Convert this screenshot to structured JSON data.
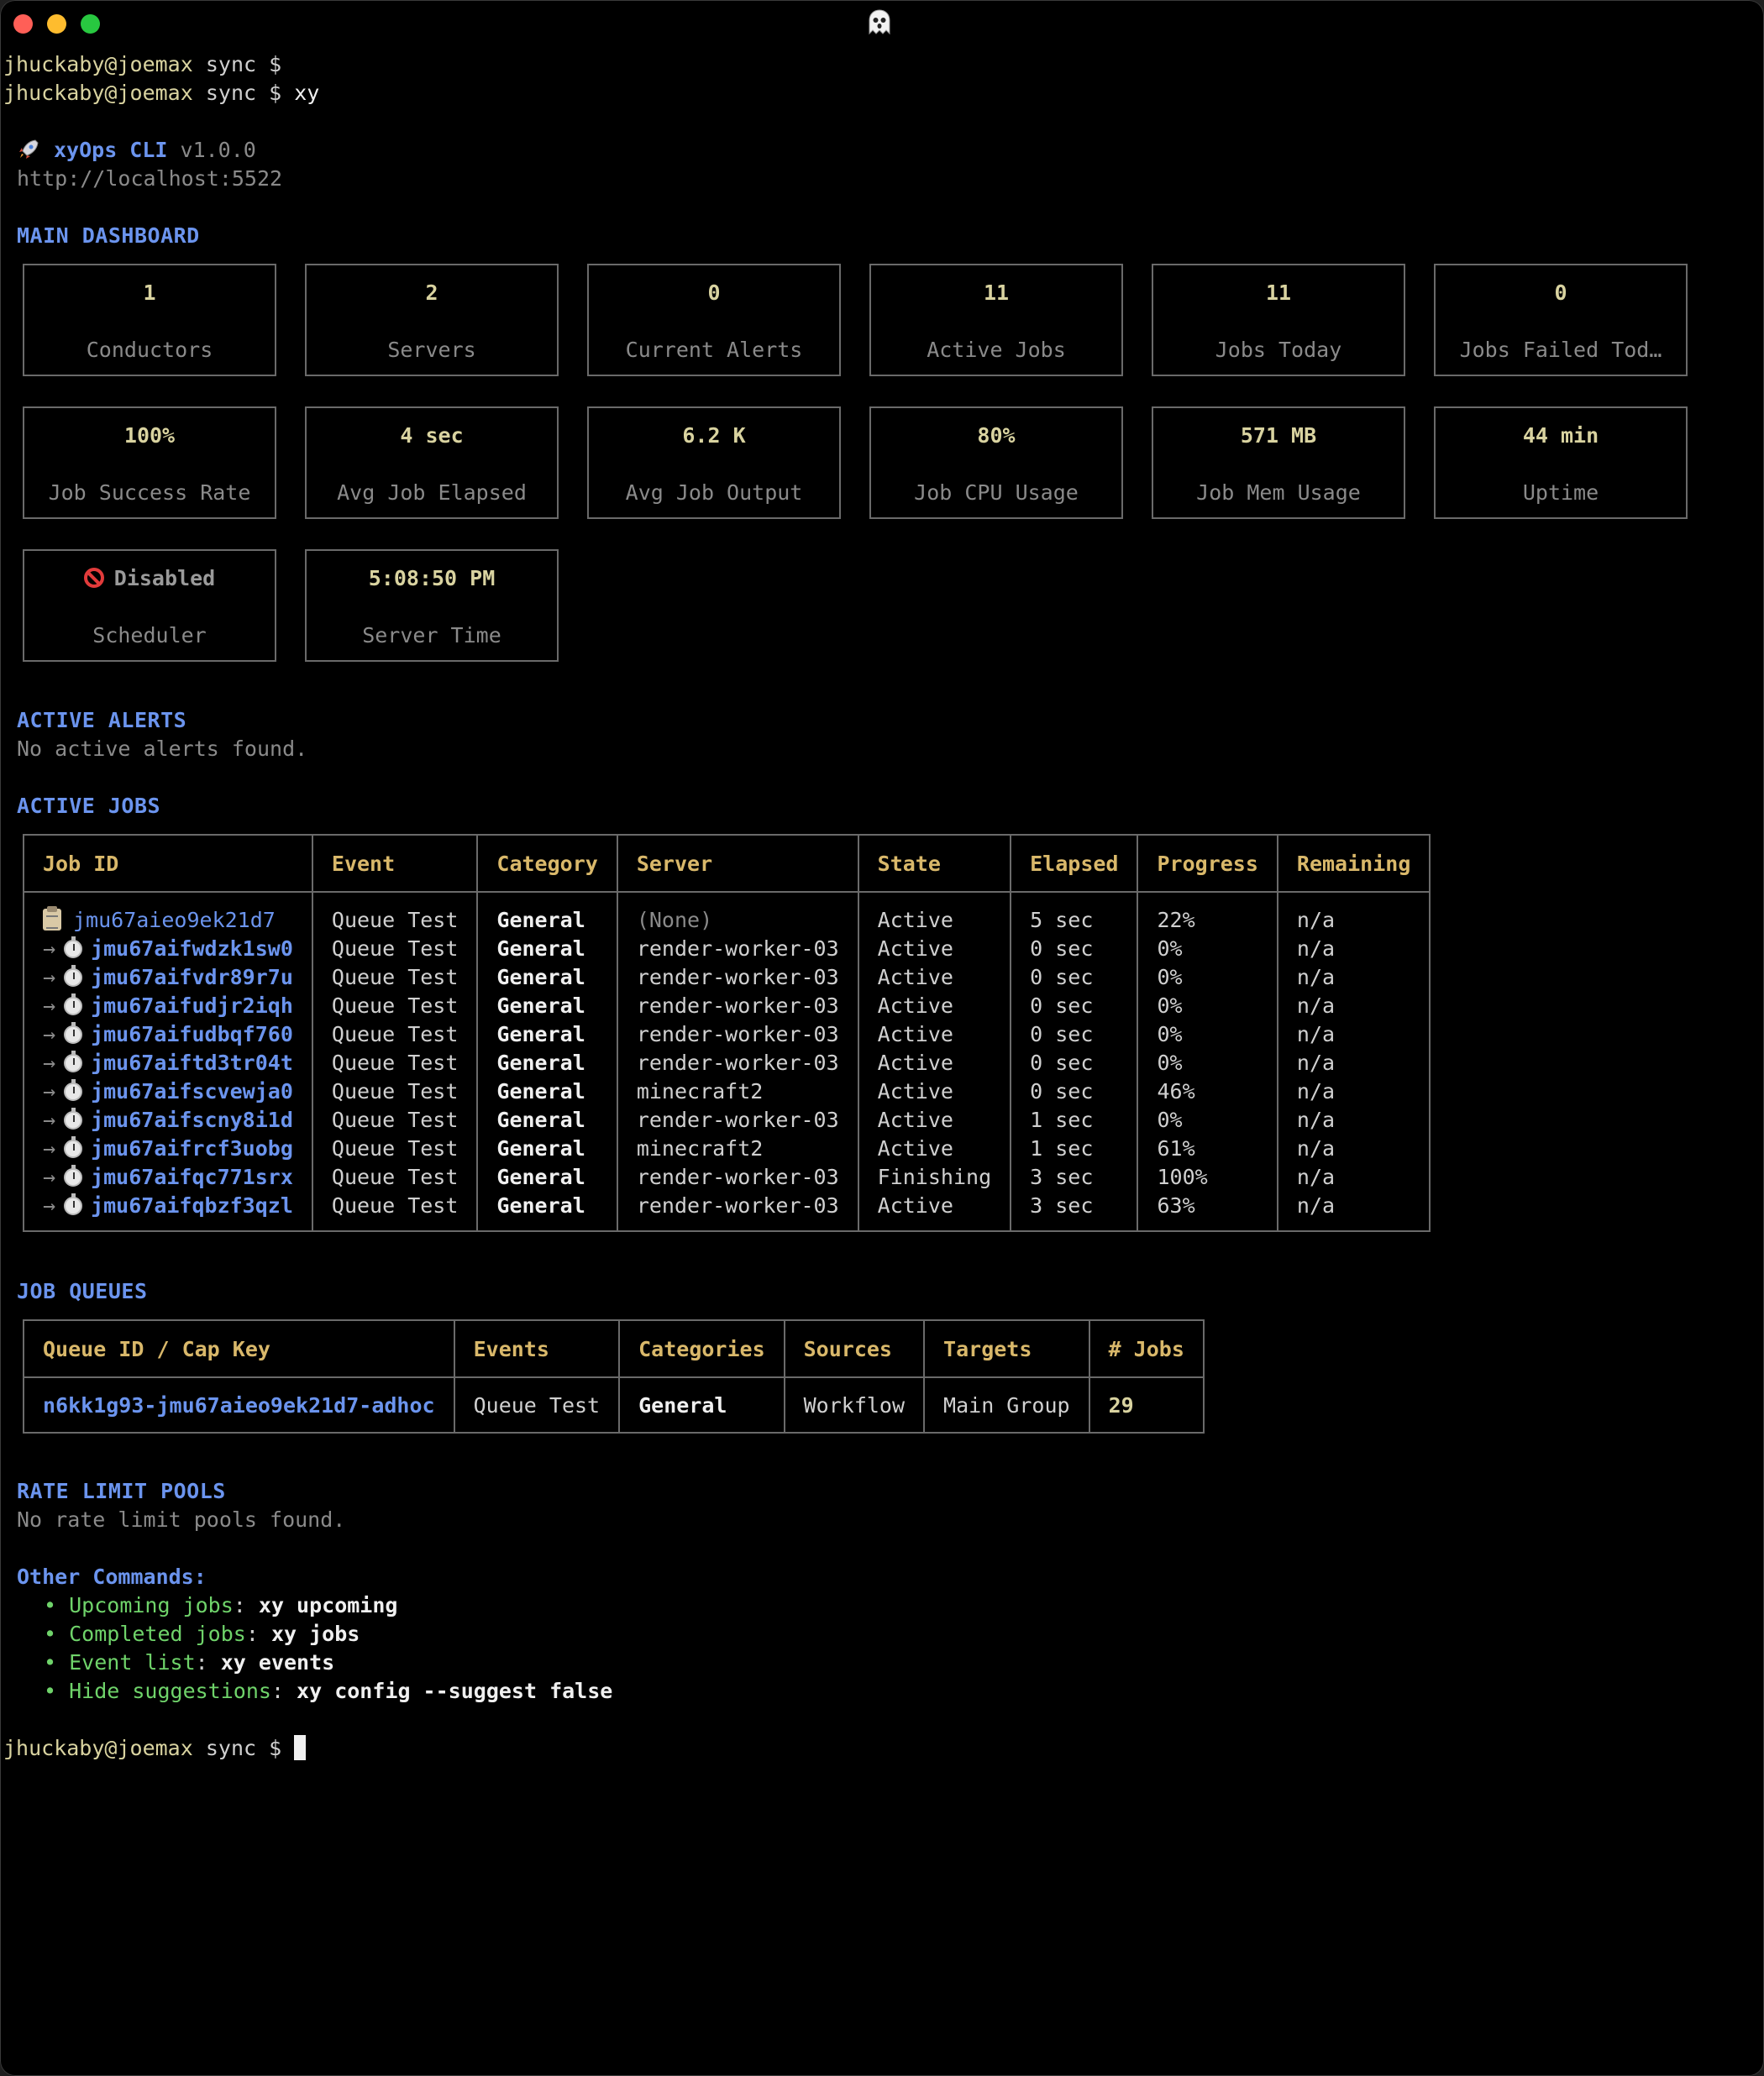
{
  "prompt": {
    "user_host": "jhuckaby@joemax",
    "dir": "sync",
    "symbol": "$",
    "command": "xy"
  },
  "banner": {
    "app_name": "xyOps CLI",
    "version": "v1.0.0",
    "url": "http://localhost:5522"
  },
  "dashboard": {
    "heading": "MAIN DASHBOARD",
    "row1": [
      {
        "value": "1",
        "label": "Conductors"
      },
      {
        "value": "2",
        "label": "Servers"
      },
      {
        "value": "0",
        "label": "Current Alerts"
      },
      {
        "value": "11",
        "label": "Active Jobs"
      },
      {
        "value": "11",
        "label": "Jobs Today"
      },
      {
        "value": "0",
        "label": "Jobs Failed Tod…"
      }
    ],
    "row2": [
      {
        "value": "100%",
        "label": "Job Success Rate"
      },
      {
        "value": "4 sec",
        "label": "Avg Job Elapsed"
      },
      {
        "value": "6.2 K",
        "label": "Avg Job Output"
      },
      {
        "value": "80%",
        "label": "Job CPU Usage"
      },
      {
        "value": "571 MB",
        "label": "Job Mem Usage"
      },
      {
        "value": "44 min",
        "label": "Uptime"
      }
    ],
    "row3": [
      {
        "value": "Disabled",
        "label": "Scheduler"
      },
      {
        "value": "5:08:50 PM",
        "label": "Server Time"
      }
    ]
  },
  "alerts": {
    "heading": "ACTIVE ALERTS",
    "empty": "No active alerts found."
  },
  "active_jobs": {
    "heading": "ACTIVE JOBS",
    "columns": [
      "Job ID",
      "Event",
      "Category",
      "Server",
      "State",
      "Elapsed",
      "Progress",
      "Remaining"
    ],
    "rows": [
      {
        "id": "jmu67aieo9ek21d7",
        "event": "Queue Test",
        "category": "General",
        "server": "(None)",
        "state": "Active",
        "elapsed": "5 sec",
        "progress": "22%",
        "remaining": "n/a"
      },
      {
        "id": "jmu67aifwdzk1sw0",
        "event": "Queue Test",
        "category": "General",
        "server": "render-worker-03",
        "state": "Active",
        "elapsed": "0 sec",
        "progress": "0%",
        "remaining": "n/a"
      },
      {
        "id": "jmu67aifvdr89r7u",
        "event": "Queue Test",
        "category": "General",
        "server": "render-worker-03",
        "state": "Active",
        "elapsed": "0 sec",
        "progress": "0%",
        "remaining": "n/a"
      },
      {
        "id": "jmu67aifudjr2iqh",
        "event": "Queue Test",
        "category": "General",
        "server": "render-worker-03",
        "state": "Active",
        "elapsed": "0 sec",
        "progress": "0%",
        "remaining": "n/a"
      },
      {
        "id": "jmu67aifudbqf760",
        "event": "Queue Test",
        "category": "General",
        "server": "render-worker-03",
        "state": "Active",
        "elapsed": "0 sec",
        "progress": "0%",
        "remaining": "n/a"
      },
      {
        "id": "jmu67aiftd3tr04t",
        "event": "Queue Test",
        "category": "General",
        "server": "render-worker-03",
        "state": "Active",
        "elapsed": "0 sec",
        "progress": "0%",
        "remaining": "n/a"
      },
      {
        "id": "jmu67aifscvewja0",
        "event": "Queue Test",
        "category": "General",
        "server": "minecraft2",
        "state": "Active",
        "elapsed": "0 sec",
        "progress": "46%",
        "remaining": "n/a"
      },
      {
        "id": "jmu67aifscny8i1d",
        "event": "Queue Test",
        "category": "General",
        "server": "render-worker-03",
        "state": "Active",
        "elapsed": "1 sec",
        "progress": "0%",
        "remaining": "n/a"
      },
      {
        "id": "jmu67aifrcf3uobg",
        "event": "Queue Test",
        "category": "General",
        "server": "minecraft2",
        "state": "Active",
        "elapsed": "1 sec",
        "progress": "61%",
        "remaining": "n/a"
      },
      {
        "id": "jmu67aifqc771srx",
        "event": "Queue Test",
        "category": "General",
        "server": "render-worker-03",
        "state": "Finishing",
        "elapsed": "3 sec",
        "progress": "100%",
        "remaining": "n/a"
      },
      {
        "id": "jmu67aifqbzf3qzl",
        "event": "Queue Test",
        "category": "General",
        "server": "render-worker-03",
        "state": "Active",
        "elapsed": "3 sec",
        "progress": "63%",
        "remaining": "n/a"
      }
    ]
  },
  "job_queues": {
    "heading": "JOB QUEUES",
    "columns": [
      "Queue ID / Cap Key",
      "Events",
      "Categories",
      "Sources",
      "Targets",
      "# Jobs"
    ],
    "rows": [
      {
        "id": "n6kk1g93-jmu67aieo9ek21d7-adhoc",
        "events": "Queue Test",
        "categories": "General",
        "sources": "Workflow",
        "targets": "Main Group",
        "jobs": "29"
      }
    ]
  },
  "rate_limit": {
    "heading": "RATE LIMIT POOLS",
    "empty": "No rate limit pools found."
  },
  "other_commands": {
    "heading": "Other Commands:",
    "items": [
      {
        "label": "Upcoming jobs",
        "cmd": "xy upcoming"
      },
      {
        "label": "Completed jobs",
        "cmd": "xy jobs"
      },
      {
        "label": "Event list",
        "cmd": "xy events"
      },
      {
        "label": "Hide suggestions",
        "cmd": "xy config --suggest false"
      }
    ]
  },
  "icons": {
    "title": "ghost-icon",
    "banner": "rocket-icon",
    "scheduler": "prohibited-icon",
    "parent_job": "clipboard-icon",
    "child_job": "stopwatch-icon"
  },
  "colors": {
    "background": "#000000",
    "heading": "#6b94ee",
    "value": "#d9d3a0",
    "table_header": "#d9b86a",
    "bullet": "#6fd36a"
  }
}
